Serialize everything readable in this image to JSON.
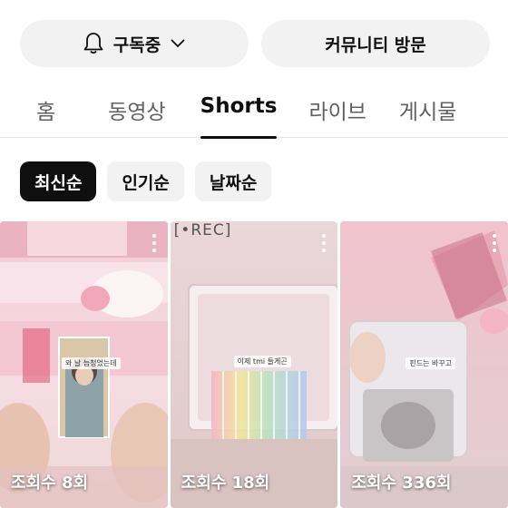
{
  "header": {
    "subscribe_label": "구독중",
    "community_label": "커뮤니티 방문"
  },
  "tabs": [
    {
      "label": "홈",
      "active": false
    },
    {
      "label": "동영상",
      "active": false
    },
    {
      "label": "Shorts",
      "active": true
    },
    {
      "label": "라이브",
      "active": false
    },
    {
      "label": "게시물",
      "active": false
    }
  ],
  "sort_chips": [
    {
      "label": "최신순",
      "active": true
    },
    {
      "label": "인기순",
      "active": false
    },
    {
      "label": "날짜순",
      "active": false
    }
  ],
  "shorts": [
    {
      "views": "조회수 8회",
      "caption": "와 날 늠청었는데"
    },
    {
      "views": "조회수 18회",
      "caption": "이제 tmi 들게곤",
      "overlay": "[•REC]"
    },
    {
      "views": "조회수 336회",
      "caption": "핀드는 바꾸고"
    }
  ],
  "colors": {
    "active_chip": "#0f0f0f",
    "pill_bg": "#f2f2f2",
    "rec_dot": "#e03030"
  }
}
